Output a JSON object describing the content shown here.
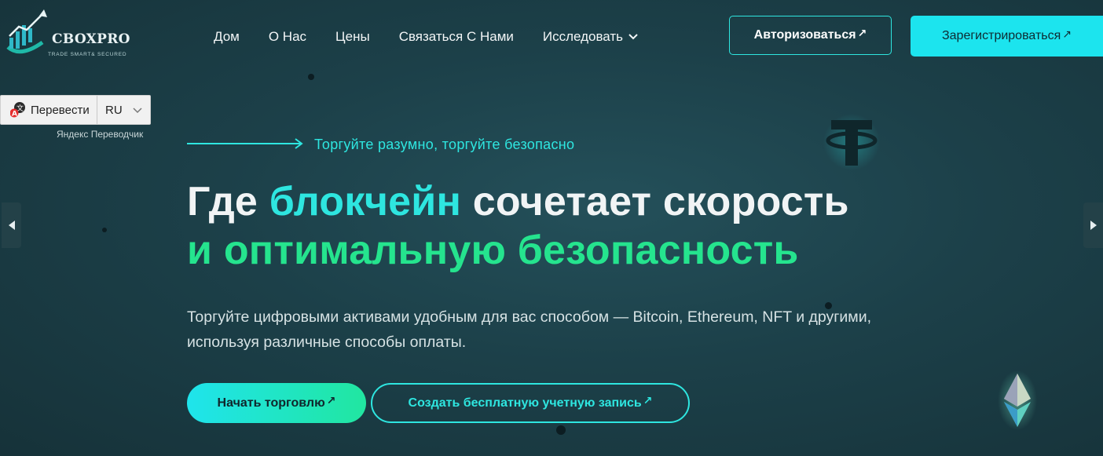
{
  "logo": {
    "name": "CBOXPRO",
    "tagline": "TRADE SMART& SECURED"
  },
  "nav": {
    "items": [
      "Дом",
      "О Нас",
      "Цены",
      "Связаться С Нами",
      "Исследовать"
    ]
  },
  "header_buttons": {
    "login": "Авторизоваться",
    "register": "Зарегистрироваться",
    "arrow": "↗"
  },
  "translate_widget": {
    "button_label": "Перевести",
    "language": "RU",
    "credit": "Яндекс Переводчик"
  },
  "hero": {
    "tagline": "Торгуйте разумно, торгуйте безопасно",
    "heading": {
      "part1": "Где ",
      "part2": "блокчейн",
      "part3": " сочетает скорость",
      "part4": "и оптимальную безопасность"
    },
    "description": "Торгуйте цифровыми активами удобным для вас способом — Bitcoin, Ethereum, NFT и другими, используя различные способы оплаты.",
    "primary_button": "Начать торговлю",
    "secondary_button": "Создать бесплатную учетную запись"
  },
  "colors": {
    "background": "#1c4049",
    "accent_cyan": "#2ee6e0",
    "accent_green": "#25e48e",
    "register_bg": "#1ce4ee"
  },
  "icons": [
    "logo-chart-icon",
    "chevron-down-icon",
    "arrow-up-right-icon",
    "translate-icon",
    "caret-left-icon",
    "caret-right-icon",
    "tether-coin-icon",
    "ethereum-coin-icon"
  ]
}
